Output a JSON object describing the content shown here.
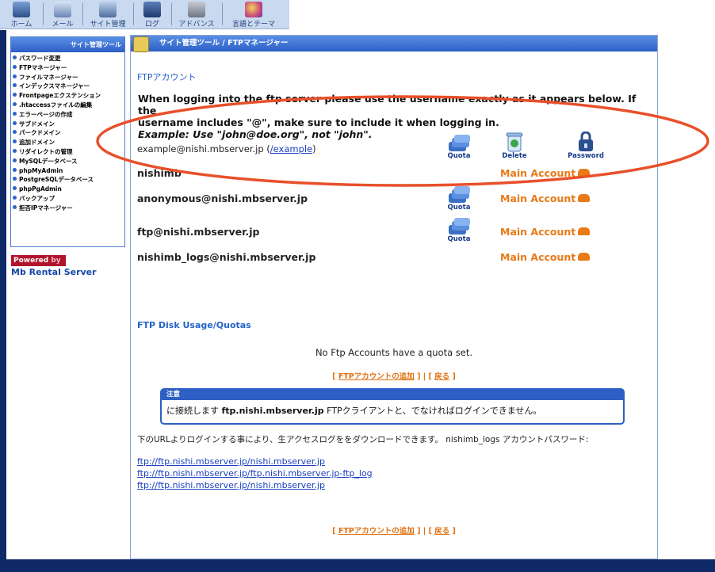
{
  "nav": {
    "items": [
      {
        "label": "ホーム",
        "icon": "home-icon"
      },
      {
        "label": "メール",
        "icon": "mail-icon"
      },
      {
        "label": "サイト管理",
        "icon": "site-icon"
      },
      {
        "label": "ログ",
        "icon": "log-icon"
      },
      {
        "label": "アドバンス",
        "icon": "advanced-icon"
      },
      {
        "label": "言語とテーマ",
        "icon": "theme-icon"
      }
    ]
  },
  "sidebar": {
    "title": "サイト管理ツール",
    "items": [
      {
        "label": "パスワード変更"
      },
      {
        "label": "FTPマネージャー"
      },
      {
        "label": "ファイルマネージャー"
      },
      {
        "label": "インデックスマネージャー"
      },
      {
        "label": "Frontpageエクステンション"
      },
      {
        "label": ".htaccessファイルの編集"
      },
      {
        "label": "エラーページの作成"
      },
      {
        "label": "サブドメイン"
      },
      {
        "label": "パークドメイン"
      },
      {
        "label": "追加ドメイン"
      },
      {
        "label": "リダイレクトの管理"
      },
      {
        "label": "MySQLデータベース"
      },
      {
        "label": "phpMyAdmin"
      },
      {
        "label": "PostgreSQLデータベース"
      },
      {
        "label": "phpPgAdmin"
      },
      {
        "label": "バックアップ"
      },
      {
        "label": "拒否IPマネージャー"
      }
    ],
    "powered_text": "Powered",
    "powered_by": "by",
    "brand": "Mb Rental Server"
  },
  "main": {
    "header": {
      "title": "サイト管理ツール / FTPマネージャー"
    },
    "section_title": "FTPアカウント",
    "instructions": {
      "line1": "When logging into the ftp server please use the username exactly as it appears below. If the",
      "line2": "username includes \"@\", make sure to include it when logging in.",
      "example": "Example: Use \"john@doe.org\", not \"john\"."
    },
    "accounts": [
      {
        "name": "example@nishi.mbserver.jp",
        "path_open": " (",
        "path": "/example",
        "path_close": ")"
      },
      {
        "name": "nishimb",
        "main": "Main Account"
      },
      {
        "name": "anonymous@nishi.mbserver.jp",
        "main": "Main Account"
      },
      {
        "name": "ftp@nishi.mbserver.jp",
        "main": "Main Account"
      },
      {
        "name": "nishimb_logs@nishi.mbserver.jp",
        "main": "Main Account"
      }
    ],
    "actions": {
      "quota": "Quota",
      "delete": "Delete",
      "password": "Password"
    },
    "disk_usage_title": "FTP Disk Usage/Quotas",
    "no_quota": "No Ftp Accounts have a quota set.",
    "links": {
      "open1": "[ ",
      "add": "FTPアカウントの追加",
      "mid": " ] | [ ",
      "back": "戻る",
      "close": " ]"
    },
    "notice": {
      "title": "注意",
      "pre": "に接続します ",
      "host": "ftp.nishi.mbserver.jp",
      "post": " FTPクライアントと、でなければログインできません。"
    },
    "logs_description": "下のURLよりログインする事により、生アクセスログををダウンロードできます。 nishimb_logs アカウントパスワード:",
    "log_links": [
      "ftp://ftp.nishi.mbserver.jp/nishi.mbserver.jp",
      "ftp://ftp.nishi.mbserver.jp/ftp.nishi.mbserver.jp-ftp_log",
      "ftp://ftp.nishi.mbserver.jp/nishi.mbserver.jp"
    ]
  },
  "colors": {
    "accent": "#2c5fc4",
    "frame": "#0f2a66",
    "orange": "#e87a18",
    "annotation": "#e8502a"
  }
}
